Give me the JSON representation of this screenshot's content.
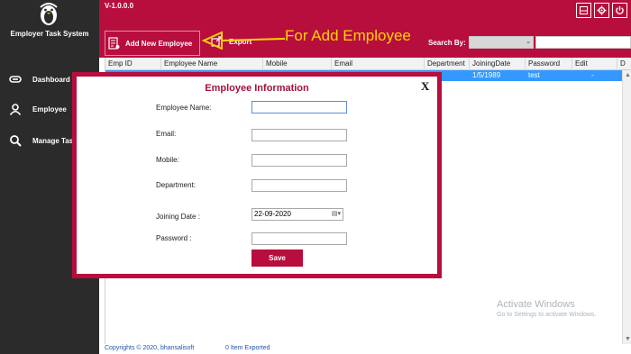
{
  "app": {
    "title": "Employer Task System",
    "version": "V-1.0.0.0"
  },
  "sidebar": {
    "items": [
      {
        "label": "Dashboard",
        "icon": "link-icon"
      },
      {
        "label": "Employee",
        "icon": "user-icon"
      },
      {
        "label": "Manage Task",
        "icon": "search-icon"
      }
    ]
  },
  "window_controls": [
    "window-icon",
    "gear-icon",
    "power-icon"
  ],
  "toolbar": {
    "add_label": "Add New Employee",
    "export_label": "Export",
    "annotation": "For Add Employee",
    "search_label": "Search By:",
    "search_select_value": "",
    "search_input_value": ""
  },
  "grid": {
    "columns": [
      "Emp ID",
      "Employee Name",
      "Mobile",
      "Email",
      "Department",
      "JoiningDate",
      "Password",
      "Edit",
      "D"
    ],
    "rows": [
      {
        "joining_date": "1/5/1989",
        "password": "test",
        "edit": "-"
      }
    ]
  },
  "watermark": {
    "title": "Activate Windows",
    "subtitle": "Go to Settings to activate Windows."
  },
  "footer": {
    "copyright": "Copyrights © 2020, bhansalisoft",
    "exported": "0 Item Exported"
  },
  "modal": {
    "title": "Employee Information",
    "close": "X",
    "fields": {
      "name_label": "Employee Name:",
      "name_value": "",
      "email_label": "Email:",
      "email_value": "",
      "mobile_label": "Mobile:",
      "mobile_value": "",
      "department_label": "Department:",
      "department_value": "",
      "joining_label": "Joining Date :",
      "joining_value": "22-09-2020",
      "password_label": "Password :",
      "password_value": ""
    },
    "save_label": "Save"
  },
  "colors": {
    "accent": "#b70e3e",
    "sidebar": "#2b2b2b",
    "selection": "#3399ff",
    "annotation": "#ffd200"
  }
}
